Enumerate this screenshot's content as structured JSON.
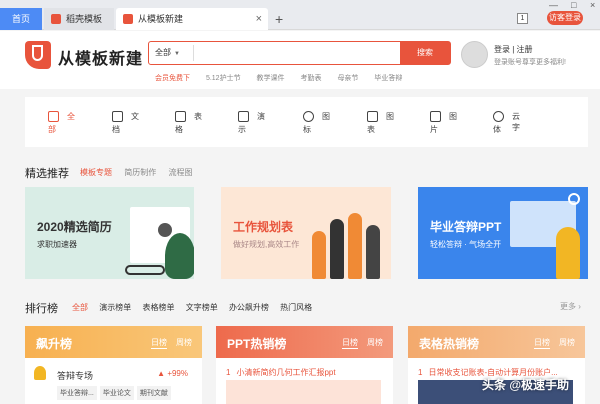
{
  "tabbar": {
    "home_label": "首页",
    "tabs": [
      {
        "label": "稻壳模板"
      },
      {
        "label": "从模板新建",
        "close": "×"
      }
    ],
    "add": "+",
    "tab_count": "1",
    "guest_login": "访客登录",
    "window_controls": [
      "—",
      "□",
      "×"
    ]
  },
  "header": {
    "logo_text": "从模板新建",
    "search": {
      "scope": "全部",
      "scope_caret": "▼",
      "placeholder": "",
      "button": "搜索"
    },
    "hotwords": [
      "会员免费下",
      "5.12护士节",
      "教学课件",
      "考勤表",
      "母亲节",
      "毕业答辩"
    ],
    "login_label": "登录 | 注册",
    "login_sub": "登录账号尊享更多福利!"
  },
  "categories": [
    {
      "l1": "全",
      "l2": "部",
      "icon": "grid-icon"
    },
    {
      "l1": "文",
      "l2": "档",
      "icon": "doc-icon"
    },
    {
      "l1": "表",
      "l2": "格",
      "icon": "table-icon"
    },
    {
      "l1": "演",
      "l2": "示",
      "icon": "slides-icon"
    },
    {
      "l1": "图",
      "l2": "标",
      "icon": "pin-icon"
    },
    {
      "l1": "图",
      "l2": "表",
      "icon": "chart-icon"
    },
    {
      "l1": "图",
      "l2": "片",
      "icon": "image-icon"
    },
    {
      "l1": "云字",
      "l2": "体",
      "icon": "font-icon"
    }
  ],
  "recommend": {
    "title": "精选推荐",
    "tabs": [
      "模板专题",
      "简历制作",
      "流程图"
    ],
    "banners": [
      {
        "title": "2020精选简历",
        "subtitle": "求职加速器"
      },
      {
        "title": "工作规划表",
        "subtitle": "做好规划,高效工作"
      },
      {
        "title": "毕业答辩PPT",
        "subtitle": "轻松答辩 · 气场全开"
      }
    ]
  },
  "ranking": {
    "title": "排行榜",
    "tabs": [
      "全部",
      "演示榜单",
      "表格榜单",
      "文字榜单",
      "办公飙升榜",
      "热门风格"
    ],
    "more": "更多 ›",
    "cards": [
      {
        "title": "飙升榜",
        "daily": "日榜",
        "weekly": "周榜",
        "item": "答辩专场",
        "rise": "▲ +99%",
        "chips": [
          "毕业答辩...",
          "毕业论文",
          "期刊文献"
        ]
      },
      {
        "title": "PPT热销榜",
        "daily": "日榜",
        "weekly": "周榜",
        "num": "1",
        "item": "小清新简约几何工作汇报ppt"
      },
      {
        "title": "表格热销榜",
        "daily": "日榜",
        "weekly": "周榜",
        "num": "1",
        "item": "日常收支记账表-自动计算月份账户..."
      }
    ]
  },
  "watermark": "头条 @极速手助",
  "colors": {
    "accent": "#e8543c",
    "tab_blue": "#4d8bf5"
  }
}
